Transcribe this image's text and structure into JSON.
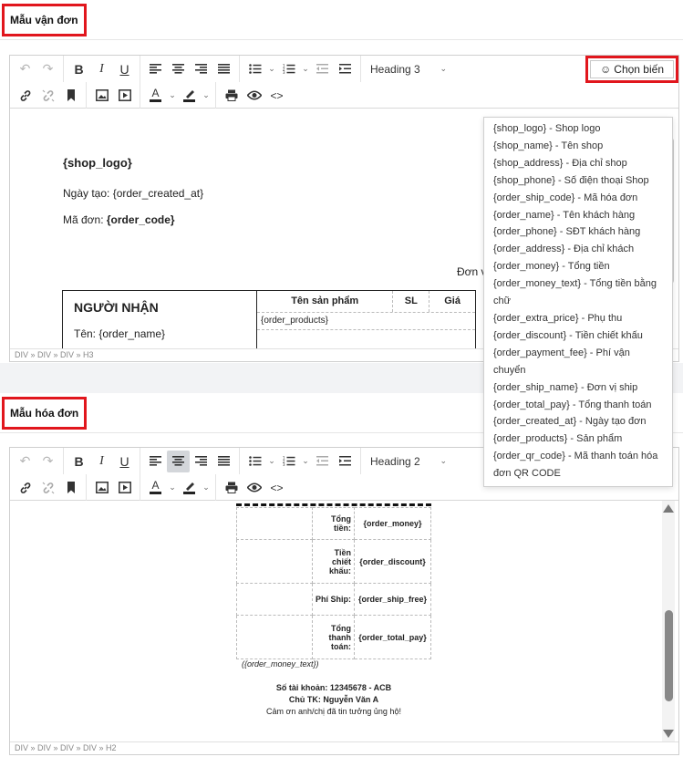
{
  "shipping_section": {
    "title": "Mẫu vận đơn"
  },
  "invoice_section": {
    "title": "Mẫu hóa đơn"
  },
  "toolbar": {
    "heading_top": "Heading 3",
    "heading_bottom": "Heading 2",
    "insert_variable_label": "Chọn biến",
    "text_color_glyph": "A"
  },
  "shipping_editor": {
    "shop_logo": "{shop_logo}",
    "created_line": "Ngày tạo: {order_created_at}",
    "order_code_label": "Mã đơn: ",
    "order_code_value": "{order_code}",
    "right_fragment": "Đơn v",
    "receiver_heading": "NGƯỜI NHẬN",
    "receiver_name": "Tên: {order_name}",
    "product_headers": [
      "Tên sản phẩm",
      "SL",
      "Giá"
    ],
    "products_placeholder": "{order_products}",
    "status_path": "DIV » DIV » DIV » H3"
  },
  "variables": [
    "{shop_logo} - Shop logo",
    "{shop_name} - Tên shop",
    "{shop_address} - Địa chỉ shop",
    "{shop_phone} - Số điện thoại Shop",
    "{order_ship_code} - Mã hóa đơn",
    "{order_name} - Tên khách hàng",
    "{order_phone} - SĐT khách hàng",
    "{order_address} - Địa chỉ khách",
    "{order_money} - Tổng tiền",
    "{order_money_text} - Tổng tiền bằng chữ",
    "{order_extra_price} - Phụ thu",
    "{order_discount} - Tiền chiết khấu",
    "{order_payment_fee} - Phí vận chuyển",
    "{order_ship_name} - Đơn vị ship",
    "{order_total_pay} - Tổng thanh toán",
    "{order_created_at} - Ngày tạo đơn",
    "{order_products} - Sản phẩm",
    "{order_qr_code} - Mã thanh toán hóa đơn QR CODE"
  ],
  "invoice_editor": {
    "rows": [
      {
        "label": "Tổng tiền:",
        "value": "{order_money}"
      },
      {
        "label": "Tiền chiết khấu:",
        "value": "{order_discount}"
      },
      {
        "label": "Phí Ship:",
        "value": "{order_ship_free}"
      },
      {
        "label": "Tổng thanh toán:",
        "value": "{order_total_pay}"
      }
    ],
    "money_text": "({order_money_text})",
    "account_line": "Số tài khoản: 12345678 - ACB",
    "owner_line": "Chủ TK: Nguyễn Văn A",
    "thanks_line": "Cảm ơn anh/chị đã tin tưởng ủng hộ!",
    "status_path": "DIV » DIV » DIV » DIV » H2"
  },
  "icons": [
    "undo-icon",
    "redo-icon",
    "bold-icon",
    "italic-icon",
    "underline-icon",
    "align-left-icon",
    "align-center-icon",
    "align-right-icon",
    "align-justify-icon",
    "bullet-list-icon",
    "numbered-list-icon",
    "outdent-icon",
    "indent-icon",
    "link-icon",
    "unlink-icon",
    "bookmark-icon",
    "image-icon",
    "video-icon",
    "text-color-icon",
    "highlight-icon",
    "print-icon",
    "preview-icon",
    "code-icon",
    "smiley-icon"
  ],
  "colors": {
    "highlight_border": "#e1161d",
    "active_button": "#d3d6da"
  }
}
